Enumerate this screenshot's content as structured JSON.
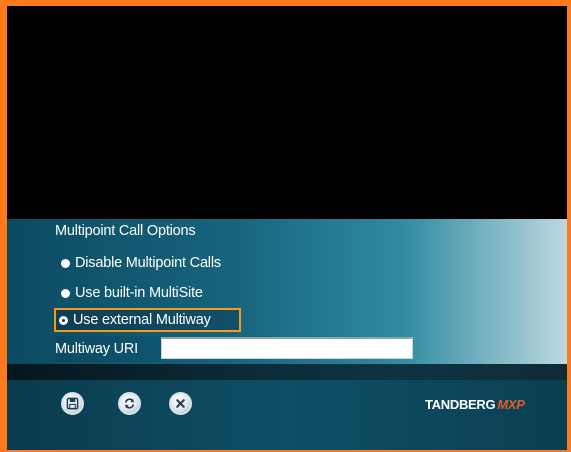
{
  "menu": {
    "title": "Multipoint Call Options",
    "options": [
      {
        "label": "Disable Multipoint Calls",
        "selected": false
      },
      {
        "label": "Use built-in MultiSite",
        "selected": false
      },
      {
        "label": "Use external Multiway",
        "selected": true,
        "focused": true
      }
    ],
    "uri": {
      "label": "Multiway URI",
      "value": ""
    }
  },
  "toolbar": {
    "buttons": [
      {
        "name": "save",
        "icon": "floppy-disk-icon"
      },
      {
        "name": "refresh",
        "icon": "refresh-icon"
      },
      {
        "name": "cancel",
        "icon": "close-icon"
      }
    ]
  },
  "brand": {
    "name": "TANDBERG",
    "suffix": "MXP"
  },
  "colors": {
    "frame_border": "#ff7a1a",
    "focus_border": "#f39a1f",
    "brand_suffix": "#e35a2a",
    "panel": "#16647c"
  }
}
